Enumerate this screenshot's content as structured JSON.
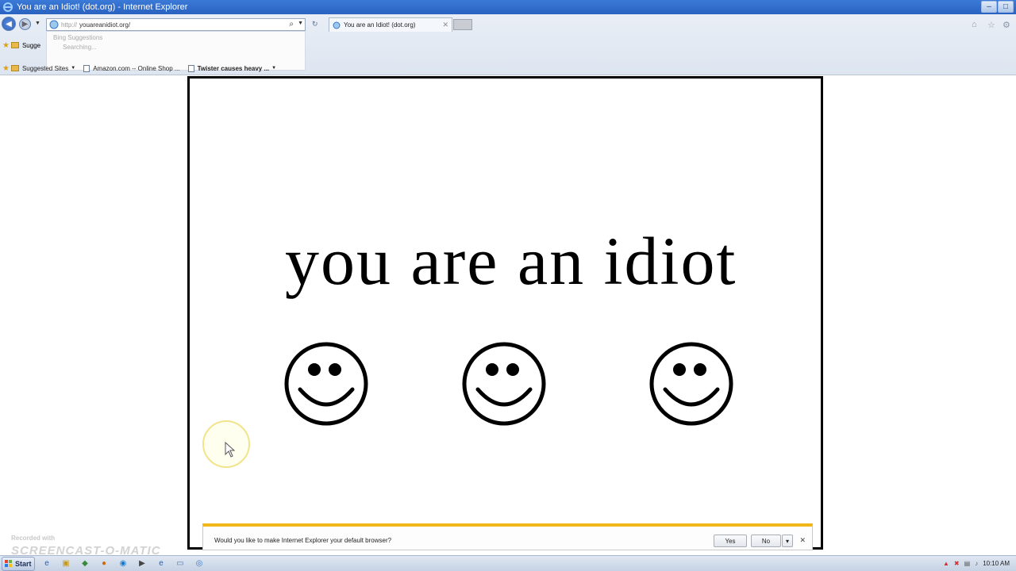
{
  "window": {
    "title": "You are an Idiot! (dot.org) - Internet Explorer",
    "controls": [
      "–",
      "□",
      "✕"
    ]
  },
  "toolbar": {
    "address_protocol": "http://",
    "address_url": "youareanidiot.org/",
    "suggestions": [
      "Bing Suggestions",
      "Searching..."
    ],
    "tab_title": "You are an Idiot! (dot.org)",
    "tab_close": "✕"
  },
  "favorites_bar": {
    "top_item": "Sugge",
    "items": [
      {
        "label": "Suggested Sites",
        "icon": "folder-icon",
        "has_menu": true
      },
      {
        "label": "Amazon.com -- Online Shop ...",
        "icon": "page-icon",
        "has_menu": false
      },
      {
        "label": "Twister causes heavy ...",
        "icon": "page-icon",
        "has_menu": true,
        "bold": true
      }
    ]
  },
  "page": {
    "headline": "you are an idiot",
    "smileys": [
      {
        "name": "smiley-face"
      },
      {
        "name": "smiley-face"
      },
      {
        "name": "smiley-face"
      }
    ]
  },
  "infobar": {
    "message": "Would you like to make Internet Explorer your default browser?",
    "yes_label": "Yes",
    "no_label": "No",
    "dropdown": "▾",
    "close": "✕"
  },
  "watermark": {
    "line1": "Recorded with",
    "brand": "SCREENCAST-O-MATIC"
  },
  "taskbar": {
    "start_label": "Start",
    "clock": "10:10 AM"
  },
  "colors": {
    "titlebar": "#2a62c0",
    "infobar_accent": "#f1b61a",
    "popup_border": "#000000"
  }
}
